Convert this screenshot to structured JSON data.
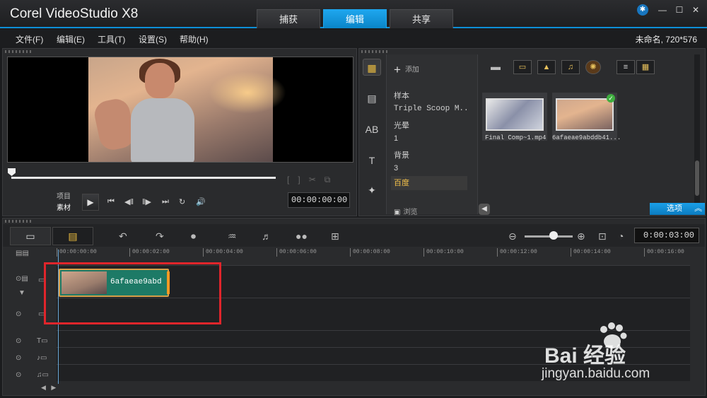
{
  "app": {
    "title": "Corel VideoStudio X8"
  },
  "tabs": [
    {
      "label": "捕获",
      "active": false
    },
    {
      "label": "编辑",
      "active": true
    },
    {
      "label": "共享",
      "active": false
    }
  ],
  "menu": [
    "文件(F)",
    "编辑(E)",
    "工具(T)",
    "设置(S)",
    "帮助(H)"
  ],
  "project_info": "未命名, 720*576",
  "player": {
    "mode_project": "项目",
    "mode_clip": "素材",
    "timecode": "00:00:00:00"
  },
  "library": {
    "add_label": "添加",
    "folders": [
      {
        "label": "样本",
        "selected": false,
        "mono": false
      },
      {
        "label": "Triple Scoop M...",
        "selected": false,
        "mono": true
      },
      {
        "label": "光晕",
        "selected": false,
        "mono": false
      },
      {
        "label": "1",
        "selected": false,
        "mono": false
      },
      {
        "label": "背景",
        "selected": false,
        "mono": false
      },
      {
        "label": "3",
        "selected": false,
        "mono": false
      },
      {
        "label": "百度",
        "selected": true,
        "mono": false
      }
    ],
    "browse_label": "浏览",
    "thumbnails": [
      {
        "label": "Final Comp~1.mp4",
        "type": "video"
      },
      {
        "label": "6afaeae9abddb41...",
        "type": "image",
        "checked": true
      }
    ],
    "options_label": "选项",
    "accent": "#0d8fd6"
  },
  "timeline": {
    "duration": "0:00:03:00",
    "ruler_labels": [
      "00:00:00:00",
      "00:00:02:00",
      "00:00:04:00",
      "00:00:06:00",
      "00:00:08:00",
      "00:00:10:00",
      "00:00:12:00",
      "00:00:14:00",
      "00:00:16:00"
    ],
    "clip_label": "6afaeae9abd",
    "highlight_color": "#e0252b"
  },
  "watermark": {
    "logo": "Bai 经验",
    "url": "jingyan.baidu.com"
  }
}
